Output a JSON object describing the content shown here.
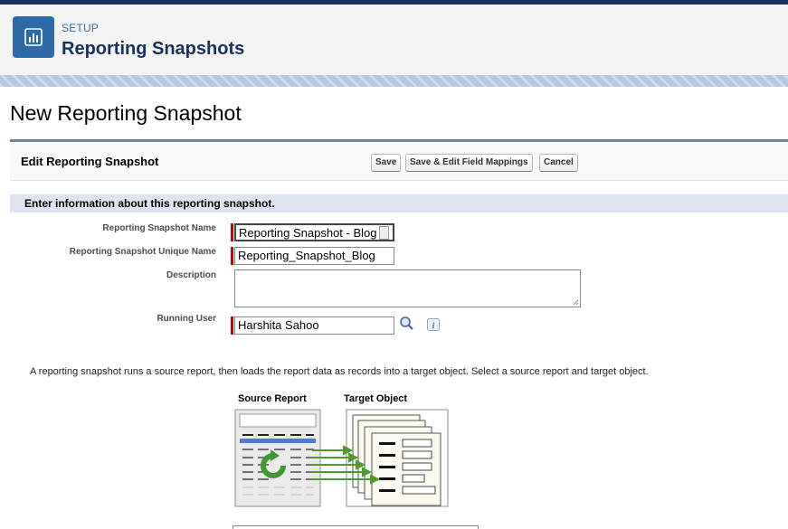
{
  "setup": {
    "kicker": "SETUP",
    "title": "Reporting Snapshots"
  },
  "page": {
    "title": "New Reporting Snapshot"
  },
  "panel": {
    "title": "Edit Reporting Snapshot",
    "buttons": {
      "save": "Save",
      "save_edit": "Save & Edit Field Mappings",
      "cancel": "Cancel"
    },
    "section_text": "Enter information about this reporting snapshot."
  },
  "fields": {
    "name_label": "Reporting Snapshot Name",
    "name_value": "Reporting Snapshot - Blog",
    "unique_label": "Reporting Snapshot Unique Name",
    "unique_value": "Reporting_Snapshot_Blog",
    "description_label": "Description",
    "description_value": "",
    "running_user_label": "Running User",
    "running_user_value": "Harshita Sahoo"
  },
  "info_text": "A reporting snapshot runs a source report, then loads the report data as records into a target object. Select a source report and target object.",
  "diagram": {
    "source_label": "Source Report",
    "target_label": "Target Object"
  },
  "icons": {
    "setup": "reports-chart-icon",
    "lookup": "lookup-magnifier-icon",
    "info": "info-icon"
  },
  "colors": {
    "header_bg": "#f3f3f3",
    "navy": "#16325c",
    "accent_blue": "#2d6ba8",
    "section_bar": "#dde4ef",
    "required": "#cc0000",
    "arrow_green": "#4f9a2f"
  }
}
